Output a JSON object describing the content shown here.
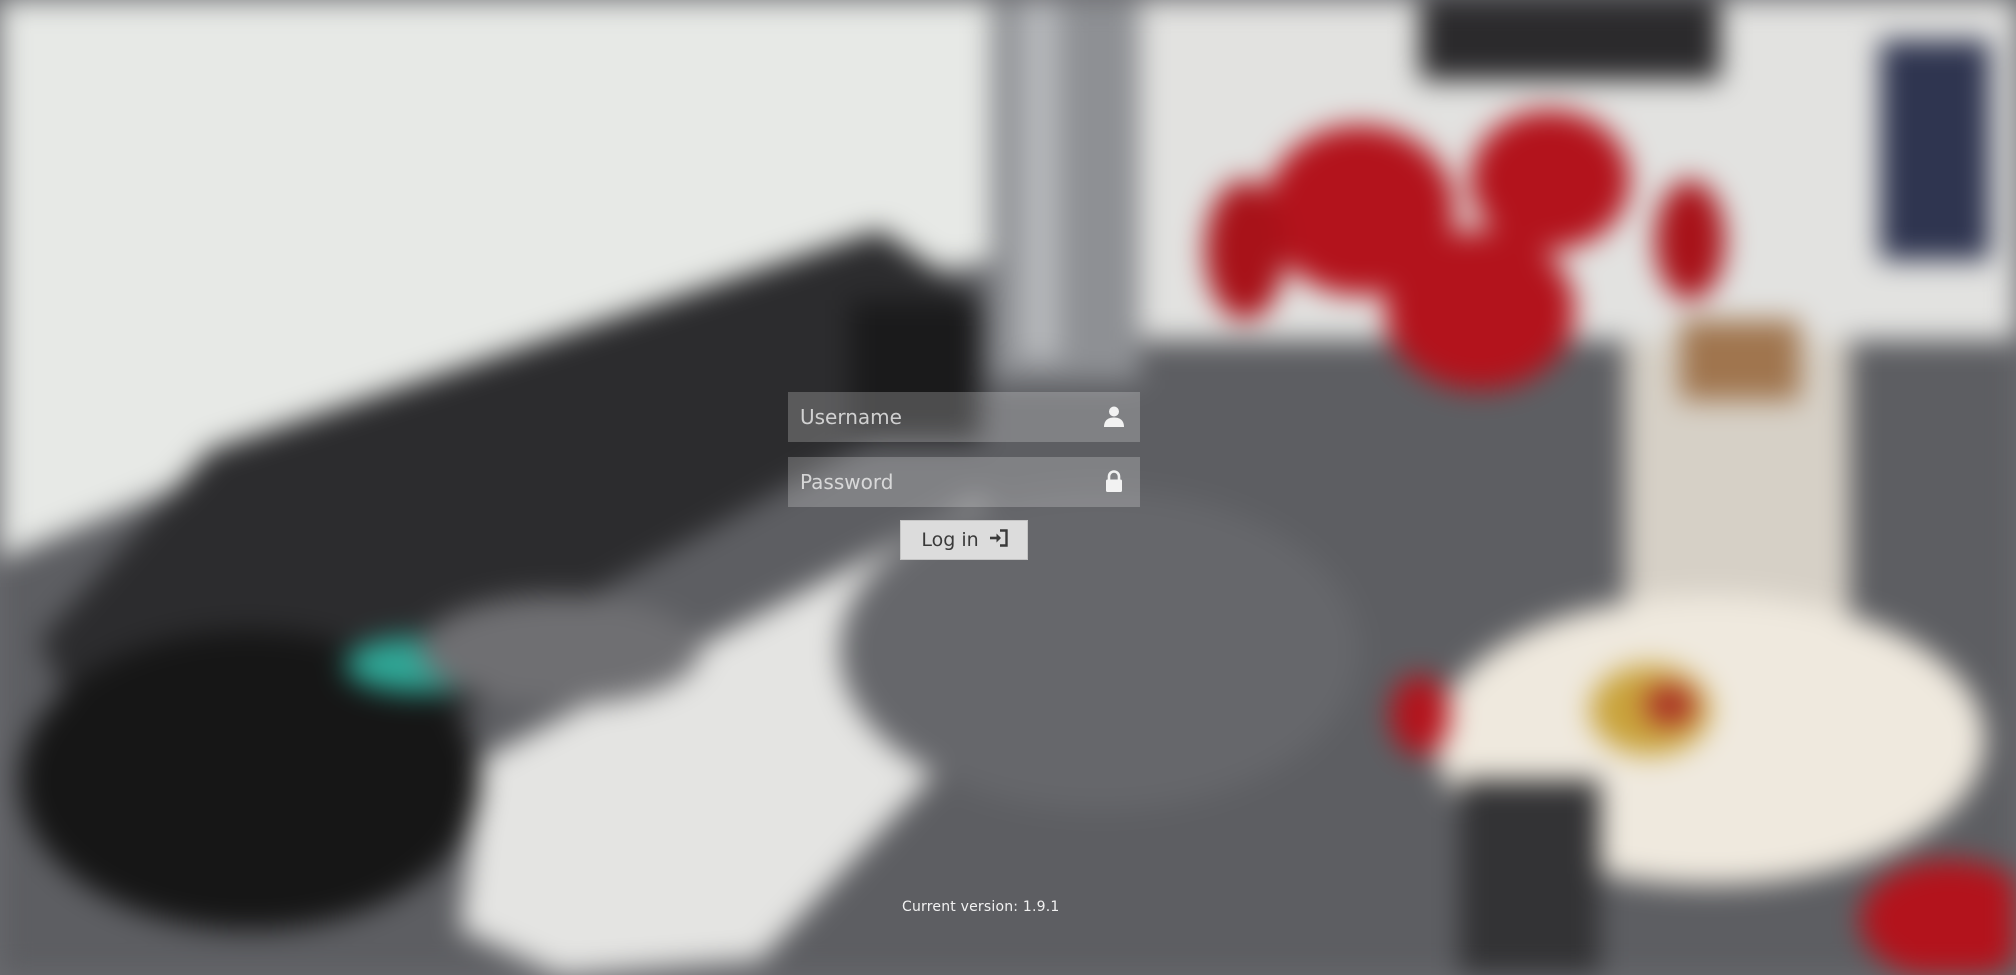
{
  "login": {
    "username_placeholder": "Username",
    "password_placeholder": "Password",
    "button_label": "Log in"
  },
  "footer": {
    "version": "Current version: 1.9.1"
  },
  "icons": {
    "username": "user-icon",
    "password": "lock-icon",
    "button": "sign-in-icon"
  },
  "colors": {
    "field_bg": "rgba(255,255,255,0.22)",
    "button_bg": "#dcdcdc",
    "accent_red": "#b3131c"
  }
}
